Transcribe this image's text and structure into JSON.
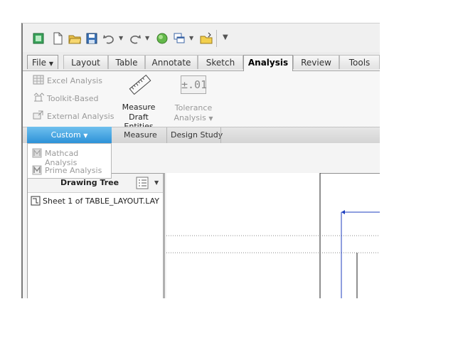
{
  "toolbar": {
    "quick_access_icons": [
      "view-icon",
      "new-file-icon",
      "open-folder-icon",
      "save-icon",
      "undo-icon",
      "redo-icon",
      "regenerate-icon",
      "windows-icon",
      "folder-icon",
      "customize-icon"
    ]
  },
  "tabs": [
    {
      "label": "File",
      "id": "file"
    },
    {
      "label": "Layout",
      "id": "layout"
    },
    {
      "label": "Table",
      "id": "table"
    },
    {
      "label": "Annotate",
      "id": "annotate"
    },
    {
      "label": "Sketch",
      "id": "sketch"
    },
    {
      "label": "Analysis",
      "id": "analysis",
      "active": true
    },
    {
      "label": "Review",
      "id": "review"
    },
    {
      "label": "Tools",
      "id": "tools"
    }
  ],
  "ribbon": {
    "custom_items": [
      "Excel Analysis",
      "Toolkit-Based",
      "External Analysis"
    ],
    "measure_label_line1": "Measure",
    "measure_label_line2": "Draft Entities",
    "tolerance_icon_text": "±.01",
    "tolerance_label_line1": "Tolerance",
    "tolerance_label_line2": "Analysis",
    "groups": {
      "custom": "Custom",
      "measure": "Measure",
      "design_study": "Design Study"
    }
  },
  "custom_dropdown": {
    "items": [
      "Mathcad Analysis",
      "Prime Analysis"
    ]
  },
  "drawing_tree": {
    "title": "Drawing Tree",
    "items": [
      "Sheet 1 of TABLE_LAYOUT.LAY"
    ]
  },
  "colors": {
    "accent": "#2d92d8",
    "disabled_text": "#9a9a9a",
    "canvas_line": "#1f3fbf"
  }
}
